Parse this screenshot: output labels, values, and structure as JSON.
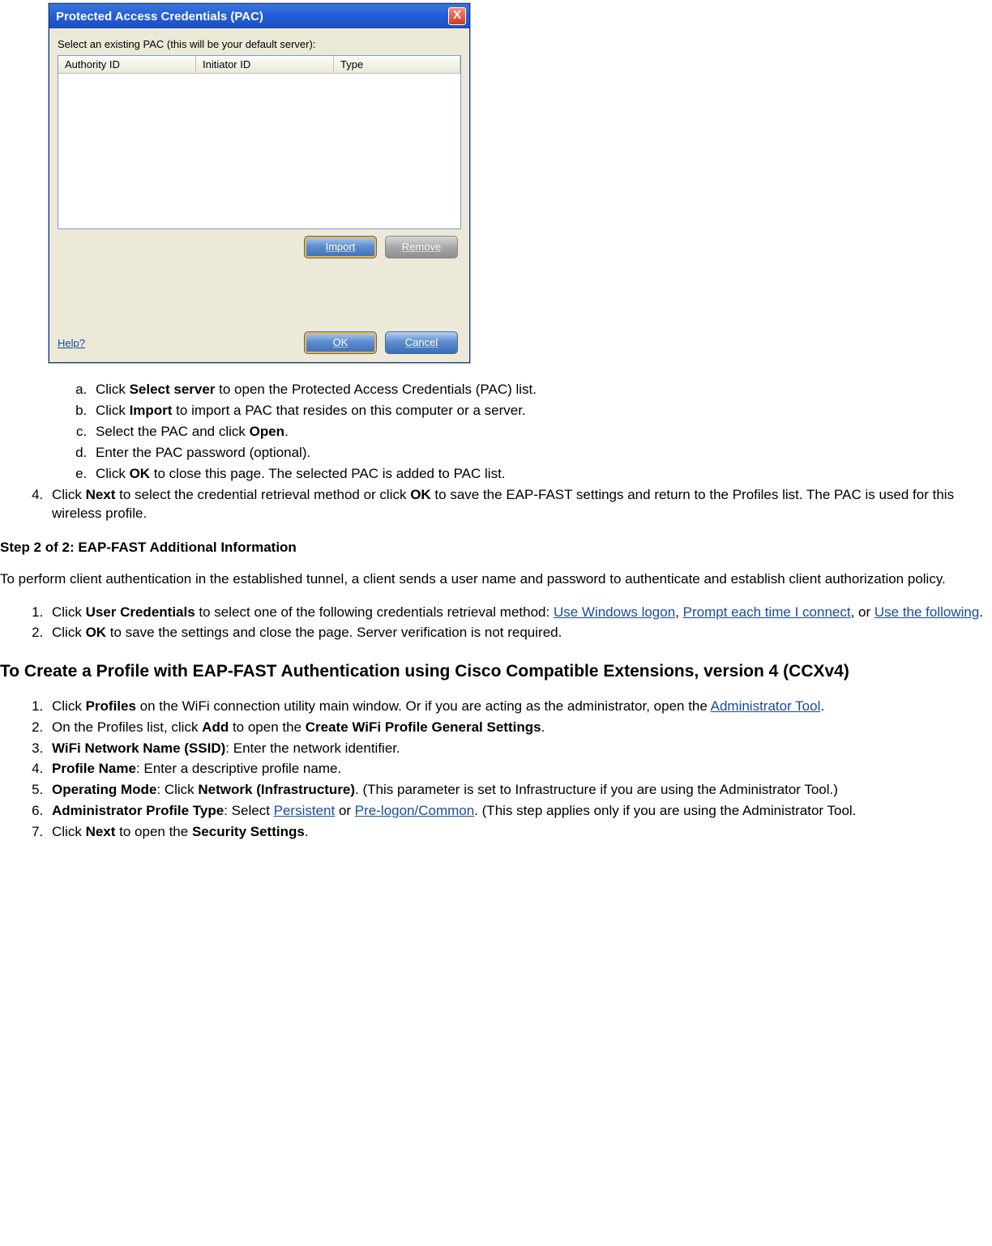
{
  "dialog": {
    "title": "Protected Access Credentials (PAC)",
    "select_label": "Select an existing PAC (this will be your default server):",
    "columns": {
      "c1": "Authority ID",
      "c2": "Initiator ID",
      "c3": "Type"
    },
    "buttons": {
      "import": "Import",
      "remove": "Remove",
      "ok": "OK",
      "cancel": "Cancel"
    },
    "help": "Help?"
  },
  "sub_a": "Click ",
  "sub_a_bold": "Select server",
  "sub_a_tail": " to open the Protected Access Credentials (PAC) list.",
  "sub_b": "Click ",
  "sub_b_bold": "Import",
  "sub_b_tail": " to import a PAC that resides on this computer or a server.",
  "sub_c": "Select the PAC and click ",
  "sub_c_bold": "Open",
  "sub_c_tail": ".",
  "sub_d": "Enter the PAC password (optional).",
  "sub_e": "Click ",
  "sub_e_bold": "OK",
  "sub_e_tail": " to close this page. The selected PAC is added to PAC list.",
  "item4_a": "Click ",
  "item4_b": "Next",
  "item4_c": " to select the credential retrieval method or click ",
  "item4_d": "OK",
  "item4_e": " to save the EAP-FAST settings and return to the Profiles list. The PAC is used for this wireless profile.",
  "step_heading": "Step 2 of 2: EAP-FAST Additional Information",
  "step_para": "To perform client authentication in the established tunnel, a client sends a user name and password to authenticate and establish client authorization policy.",
  "s2_1_a": "Click ",
  "s2_1_b": "User Credentials",
  "s2_1_c": " to select one of the following credentials retrieval method: ",
  "s2_1_link1": "Use Windows logon",
  "s2_1_sep1": ", ",
  "s2_1_link2": "Prompt each time I connect",
  "s2_1_sep2": ", or ",
  "s2_1_link3": "Use the following",
  "s2_1_tail": ".",
  "s2_2_a": "Click ",
  "s2_2_b": "OK",
  "s2_2_c": " to save the settings and close the page. Server verification is not required.",
  "h3": "To Create a Profile with EAP-FAST Authentication using Cisco Compatible Extensions, version 4 (CCXv4)",
  "c1_a": "Click ",
  "c1_b": "Profiles",
  "c1_c": " on the WiFi connection utility main window. Or if you are acting as the administrator, open the ",
  "c1_link": "Administrator Tool",
  "c1_tail": ".",
  "c2_a": "On the Profiles list, click ",
  "c2_b": "Add",
  "c2_c": " to open the ",
  "c2_d": "Create WiFi Profile General Settings",
  "c2_e": ".",
  "c3_a": "WiFi Network Name (SSID)",
  "c3_b": ": Enter the network identifier.",
  "c4_a": "Profile Name",
  "c4_b": ": Enter a descriptive profile name.",
  "c5_a": "Operating Mode",
  "c5_b": ": Click ",
  "c5_c": "Network (Infrastructure)",
  "c5_d": ". (This parameter is set to Infrastructure if you are using the Administrator Tool.)",
  "c6_a": "Administrator Profile Type",
  "c6_b": ": Select ",
  "c6_link1": "Persistent",
  "c6_sep": " or ",
  "c6_link2": "Pre-logon/Common",
  "c6_tail": ". (This step applies only if you are using the Administrator Tool.",
  "c7_a": "Click ",
  "c7_b": "Next",
  "c7_c": " to open the ",
  "c7_d": "Security Settings",
  "c7_e": "."
}
